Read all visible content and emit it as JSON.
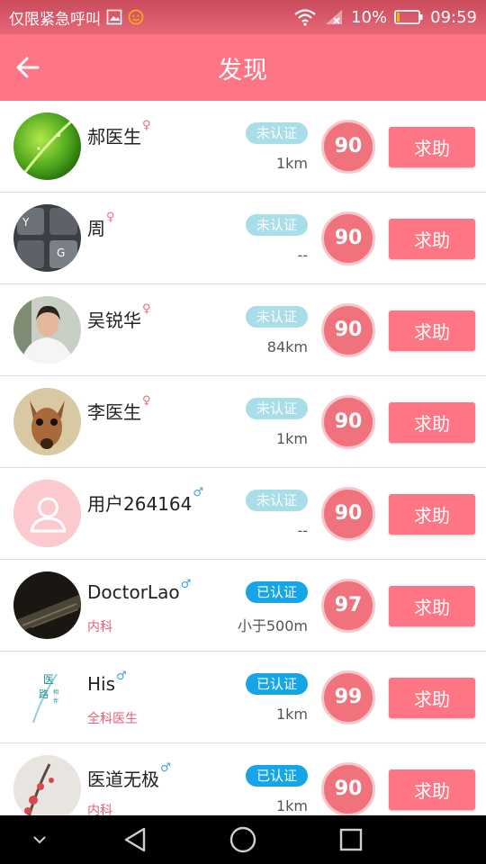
{
  "status_bar": {
    "carrier": "仅限紧急呼叫",
    "battery": "10%",
    "time": "09:59"
  },
  "header": {
    "title": "发现",
    "back_icon": "arrow-left-icon"
  },
  "colors": {
    "header": "#fe7585",
    "score": "#f0727d",
    "verified": "#16a6e6",
    "unverified": "#a9dee8",
    "department": "#e75e77"
  },
  "help_label": "求助",
  "doctors": [
    {
      "name": "郝医生",
      "gender": "♀",
      "status": "未认证",
      "verified": false,
      "department": "",
      "distance": "1km",
      "score": "90"
    },
    {
      "name": "周",
      "gender": "♀",
      "status": "未认证",
      "verified": false,
      "department": "",
      "distance": "--",
      "score": "90"
    },
    {
      "name": "吴锐华",
      "gender": "♀",
      "status": "未认证",
      "verified": false,
      "department": "",
      "distance": "84km",
      "score": "90"
    },
    {
      "name": "李医生",
      "gender": "♀",
      "status": "未认证",
      "verified": false,
      "department": "",
      "distance": "1km",
      "score": "90"
    },
    {
      "name": "用户264164",
      "gender": "♂",
      "status": "未认证",
      "verified": false,
      "department": "",
      "distance": "--",
      "score": "90"
    },
    {
      "name": "DoctorLao",
      "gender": "♂",
      "status": "已认证",
      "verified": true,
      "department": "内科",
      "distance": "小于500m",
      "score": "97"
    },
    {
      "name": "His",
      "gender": "♂",
      "status": "已认证",
      "verified": true,
      "department": "全科医生",
      "distance": "1km",
      "score": "99"
    },
    {
      "name": "医道无极",
      "gender": "♂",
      "status": "已认证",
      "verified": true,
      "department": "内科",
      "distance": "1km",
      "score": "90"
    }
  ],
  "avatar_logo_text": "医路相伴"
}
